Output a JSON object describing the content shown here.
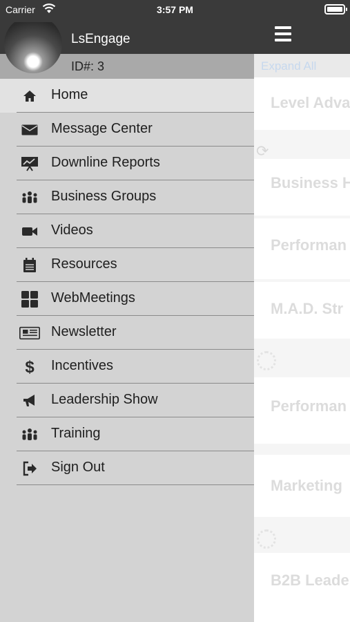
{
  "status_bar": {
    "carrier": "Carrier",
    "time": "3:57 PM"
  },
  "drawer": {
    "username": "LsEngage",
    "user_id": "ID#: 3",
    "items": [
      {
        "label": "Home",
        "icon": "home-icon"
      },
      {
        "label": "Message Center",
        "icon": "envelope-icon"
      },
      {
        "label": "Downline Reports",
        "icon": "chart-presentation-icon"
      },
      {
        "label": "Business Groups",
        "icon": "users-group-icon"
      },
      {
        "label": "Videos",
        "icon": "video-camera-icon"
      },
      {
        "label": "Resources",
        "icon": "calendar-icon"
      },
      {
        "label": "WebMeetings",
        "icon": "grid-icon"
      },
      {
        "label": "Newsletter",
        "icon": "newspaper-icon"
      },
      {
        "label": "Incentives",
        "icon": "dollar-icon"
      },
      {
        "label": "Leadership Show",
        "icon": "megaphone-icon"
      },
      {
        "label": "Training",
        "icon": "users-group-icon"
      },
      {
        "label": "Sign Out",
        "icon": "sign-out-icon"
      }
    ]
  },
  "main": {
    "expand_all": "Expand All",
    "items": [
      "Level Adva",
      "Business H",
      "Performan",
      "M.A.D. Str",
      "Performan",
      "Marketing",
      "B2B Leade"
    ]
  },
  "colors": {
    "header": "#3a3a3a",
    "drawer": "#d3d3d3",
    "active_item": "#e2e2e2"
  }
}
